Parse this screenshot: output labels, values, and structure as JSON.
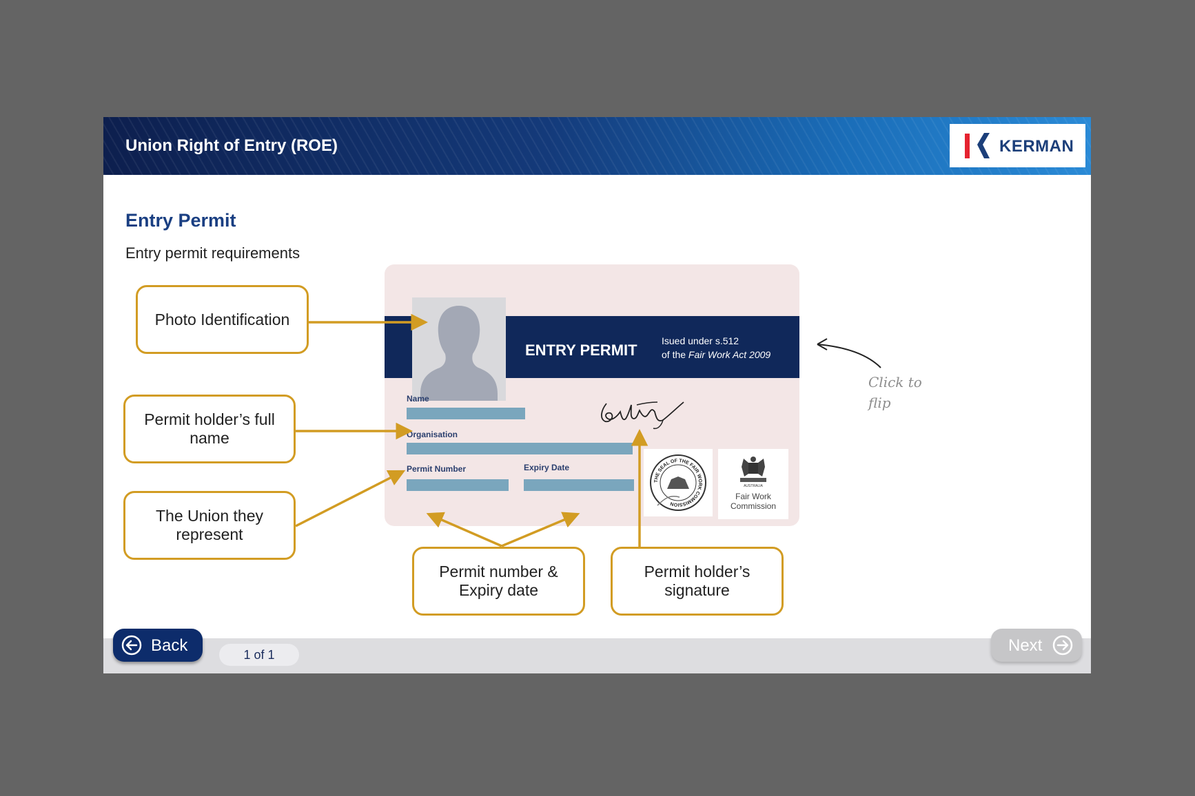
{
  "header": {
    "title": "Union Right of Entry (ROE)",
    "logo_text": "KERMAN"
  },
  "page": {
    "title": "Entry Permit",
    "subtitle": "Entry permit requirements"
  },
  "card": {
    "band_title": "ENTRY PERMIT",
    "band_sub_line1": "Isued under s.512",
    "band_sub_line2_prefix": "of the ",
    "band_sub_line2_italic": "Fair Work Act 2009",
    "labels": {
      "name": "Name",
      "organisation": "Organisation",
      "permit_number": "Permit Number",
      "expiry_date": "Expiry Date"
    },
    "seal_text": "THE SEAL OF THE FAIR WORK COMMISSION",
    "fwc_crest_text": "AUSTRALIA",
    "fwc_line1": "Fair Work",
    "fwc_line2": "Commission"
  },
  "callouts": {
    "photo": "Photo Identification",
    "name": "Permit holder’s full name",
    "union": "The Union they represent",
    "number": "Permit number & Expiry date",
    "signature": "Permit holder’s signature"
  },
  "flip_hint": {
    "line1": "Click to",
    "line2": "flip"
  },
  "nav": {
    "back_label": "Back",
    "next_label": "Next",
    "page_indicator": "1 of 1"
  },
  "colors": {
    "accent": "#d29c23",
    "navy": "#10285a",
    "card_bg": "#f3e6e6",
    "field": "#7aa6bd"
  }
}
